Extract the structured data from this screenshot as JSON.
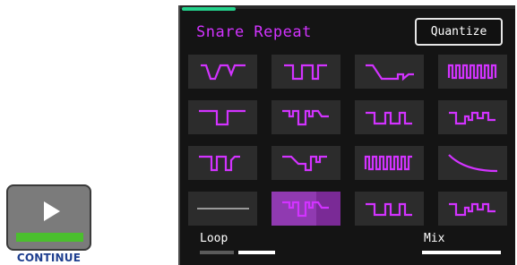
{
  "continue": {
    "label": "CONTINUE"
  },
  "device": {
    "title": "Snare Repeat",
    "quantize_label": "Quantize",
    "progress_fraction": 0.16,
    "loop_label": "Loop",
    "mix_label": "Mix",
    "loop_level": 0.5,
    "mix_level": 1.0
  },
  "colors": {
    "accent": "#d233ff",
    "cell_bg": "#2c2c2c",
    "active_cell_bg": "#7a2a96",
    "progress": "#23d18b",
    "continue_bar": "#4bbf2e"
  },
  "grid": {
    "rows": 4,
    "cols": 4,
    "selected_index": 13,
    "patterns": [
      "stutter-1",
      "stutter-2",
      "stutter-3",
      "stutter-4",
      "stutter-5",
      "stutter-6",
      "stutter-7",
      "stutter-8",
      "stutter-9",
      "stutter-10",
      "stutter-11",
      "curve-decay",
      "flat-line",
      "stutter-6",
      "stutter-7",
      "stutter-8"
    ]
  }
}
